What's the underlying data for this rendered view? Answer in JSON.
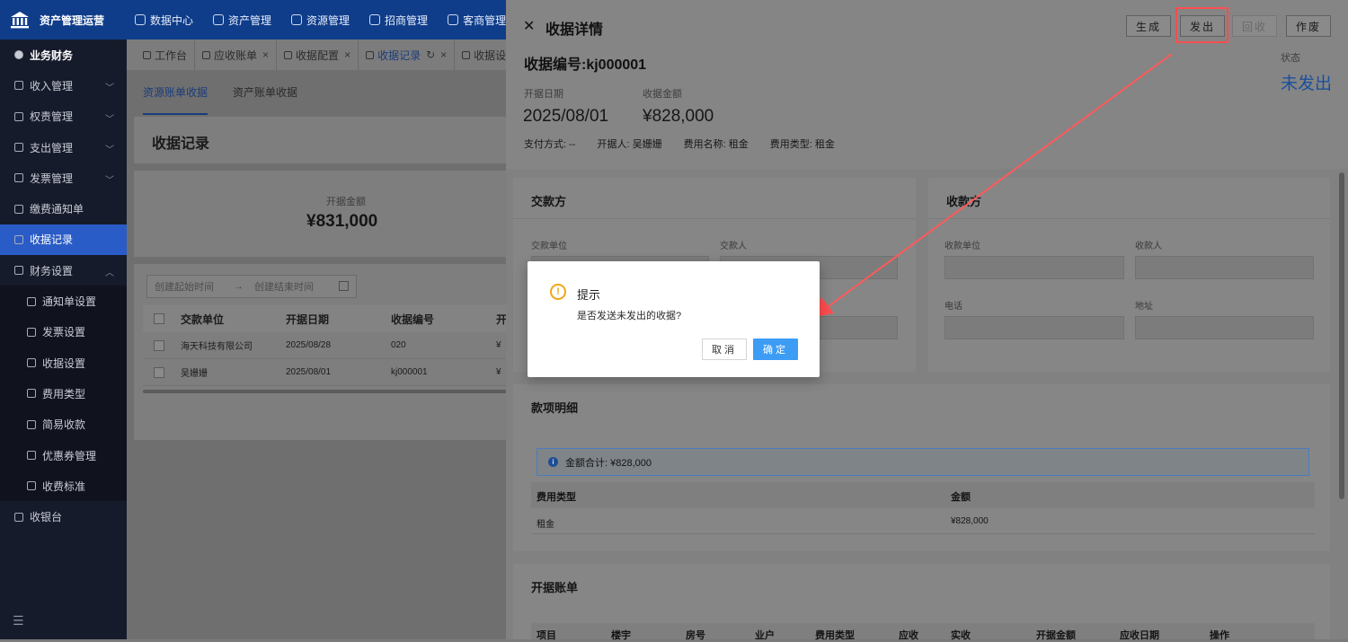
{
  "app": {
    "title": "资产管理运营"
  },
  "topnav": [
    "数据中心",
    "资产管理",
    "资源管理",
    "招商管理",
    "客商管理"
  ],
  "sidebar": {
    "items": [
      {
        "label": "业务财务",
        "type": "group"
      },
      {
        "label": "收入管理",
        "type": "item",
        "chevron": "﹀"
      },
      {
        "label": "权责管理",
        "type": "item",
        "chevron": "﹀"
      },
      {
        "label": "支出管理",
        "type": "item",
        "chevron": "﹀"
      },
      {
        "label": "发票管理",
        "type": "item",
        "chevron": "﹀"
      },
      {
        "label": "缴费通知单",
        "type": "item"
      },
      {
        "label": "收据记录",
        "type": "active"
      },
      {
        "label": "财务设置",
        "type": "item",
        "chevron": "︿"
      },
      {
        "label": "通知单设置",
        "type": "sub"
      },
      {
        "label": "发票设置",
        "type": "sub"
      },
      {
        "label": "收据设置",
        "type": "sub"
      },
      {
        "label": "费用类型",
        "type": "sub"
      },
      {
        "label": "简易收款",
        "type": "sub"
      },
      {
        "label": "优惠券管理",
        "type": "sub"
      },
      {
        "label": "收费标准",
        "type": "sub"
      },
      {
        "label": "收银台",
        "type": "item"
      }
    ],
    "collapse_icon": "☰"
  },
  "tabs": [
    {
      "label": "工作台",
      "closable": false
    },
    {
      "label": "应收账单",
      "closable": true
    },
    {
      "label": "收据配置",
      "closable": true
    },
    {
      "label": "收据记录",
      "closable": true,
      "active": true
    },
    {
      "label": "收据设",
      "closable": false
    }
  ],
  "subtabs": [
    "资源账单收据",
    "资产账单收据"
  ],
  "list_page": {
    "title": "收据记录",
    "kpi_label": "开据金额",
    "kpi_value": "¥831,000",
    "date_start_placeholder": "创建起始时间",
    "date_end_placeholder": "创建结束时间",
    "date_arrow": "→",
    "columns": [
      "交款单位",
      "开据日期",
      "收据编号",
      "开"
    ],
    "rows": [
      [
        "海天科技有限公司",
        "2025/08/28",
        "020",
        "¥"
      ],
      [
        "吴姗姗",
        "2025/08/01",
        "kj000001",
        "¥"
      ]
    ]
  },
  "drawer": {
    "close_icon": "✕",
    "title": "收据详情",
    "buttons": {
      "generate": "生成",
      "issue": "发出",
      "recall": "回收",
      "void": "作废"
    },
    "receipt_code": "收据编号:kj000001",
    "issue_date_label": "开据日期",
    "issue_date": "2025/08/01",
    "amount_label": "收据金额",
    "amount": "¥828,000",
    "meta": [
      "支付方式: --",
      "开据人: 吴姗姗",
      "费用名称: 租金",
      "费用类型: 租金"
    ],
    "status_label": "状态",
    "status_value": "未发出",
    "payer": {
      "title": "交款方",
      "unit_label": "交款单位",
      "person_label": "交款人"
    },
    "payee": {
      "title": "收款方",
      "unit_label": "收款单位",
      "person_label": "收款人",
      "phone_label": "电话",
      "address_label": "地址"
    },
    "details": {
      "title": "款项明细",
      "info_icon": "i",
      "total": "金额合计: ¥828,000",
      "columns": [
        "费用类型",
        "金额"
      ],
      "rows": [
        [
          "租金",
          "¥828,000"
        ]
      ]
    },
    "bill": {
      "title": "开据账单",
      "columns": [
        "项目",
        "楼宇",
        "房号",
        "业户",
        "费用类型",
        "应收",
        "实收",
        "开据金额",
        "应收日期",
        "操作"
      ]
    }
  },
  "modal": {
    "icon": "!",
    "title": "提示",
    "message": "是否发送未发出的收据?",
    "cancel": "取消",
    "ok": "确定"
  },
  "colors": {
    "highlight": "#ff4d4f",
    "primary": "#3d9df5",
    "warning": "#f2a516"
  }
}
